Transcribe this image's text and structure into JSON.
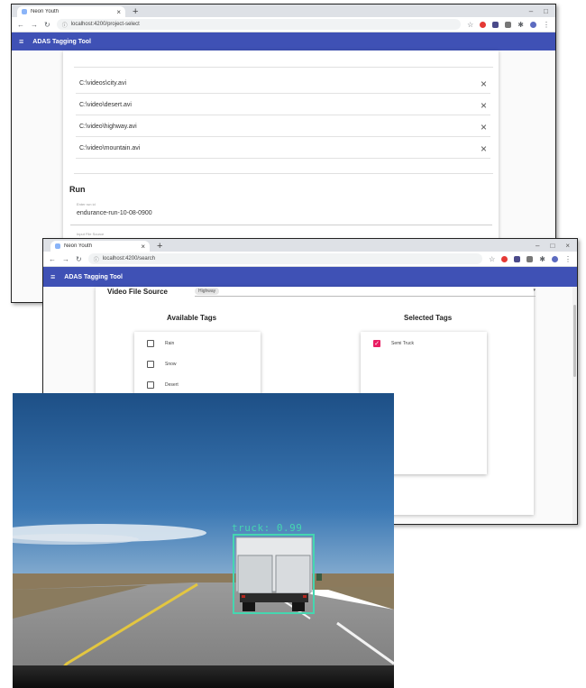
{
  "window1": {
    "tab": {
      "title": "Neon Youth",
      "close": "×"
    },
    "new_tab": "+",
    "window_controls": [
      "–",
      "□"
    ],
    "url": "localhost:4200/project-select",
    "app": {
      "menu_icon": "≡",
      "title": "ADAS Tagging Tool"
    },
    "files": [
      {
        "path": "C:\\videos\\city.avi"
      },
      {
        "path": "C:\\video\\desert.avi"
      },
      {
        "path": "C:\\video\\highway.avi"
      },
      {
        "path": "C:\\video\\mountain.avi"
      }
    ],
    "remove_glyph": "×",
    "run": {
      "heading": "Run",
      "name_label": "Enter run id",
      "name_value": "endurance-run-10-08-0900",
      "next_label": "Input File Source"
    }
  },
  "window2": {
    "tab": {
      "title": "Neon Youth",
      "close": "×"
    },
    "new_tab": "+",
    "window_controls": [
      "–",
      "□",
      "×"
    ],
    "url": "localhost:4200/search",
    "app": {
      "menu_icon": "≡",
      "title": "ADAS Tagging Tool"
    },
    "source": {
      "label": "Video File Source",
      "value": "Highway",
      "arrow": "▾"
    },
    "available_tags": {
      "heading": "Available Tags",
      "items": [
        {
          "label": "Rain"
        },
        {
          "label": "Snow"
        },
        {
          "label": "Desert"
        }
      ]
    },
    "selected_tags": {
      "heading": "Selected Tags",
      "items": [
        {
          "label": "Semi Truck",
          "check": "✓"
        }
      ]
    }
  },
  "detection": {
    "label": "truck: 0.99"
  },
  "colors": {
    "appbar": "#3f51b5",
    "checkbox_checked": "#e91e63",
    "detection_box": "#45d6b0"
  },
  "icons": [
    "tab-favicon-icon",
    "back-icon",
    "forward-icon",
    "reload-icon",
    "info-icon",
    "star-icon",
    "opera-icon",
    "extension-icon",
    "puzzle-icon",
    "profile-icon",
    "menu-icon",
    "remove-icon"
  ]
}
